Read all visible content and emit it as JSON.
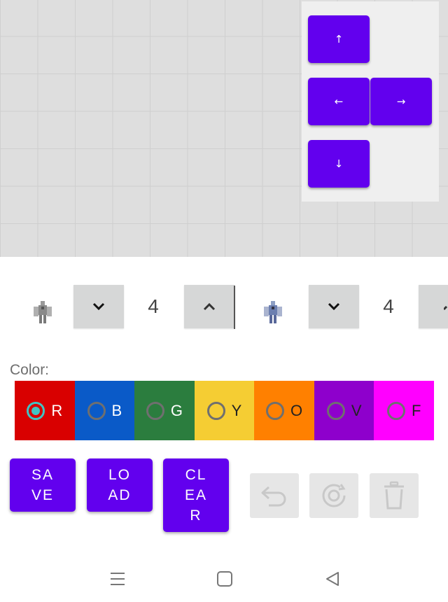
{
  "dpad": {
    "up": "↑",
    "left": "←",
    "right": "→",
    "down": "↓"
  },
  "counters": [
    {
      "sprite": "grey-robot-sprite-icon",
      "value": "4"
    },
    {
      "sprite": "blue-robot-sprite-icon",
      "value": "4"
    }
  ],
  "color_section": {
    "label": "Color:",
    "options": [
      {
        "letter": "R",
        "color": "#d90000",
        "text_color": "#ffffff",
        "checked": true
      },
      {
        "letter": "B",
        "color": "#0a5ac8",
        "text_color": "#ffffff",
        "checked": false
      },
      {
        "letter": "G",
        "color": "#2b7d3e",
        "text_color": "#ffffff",
        "checked": false
      },
      {
        "letter": "Y",
        "color": "#f5cd33",
        "text_color": "#222222",
        "checked": false
      },
      {
        "letter": "O",
        "color": "#ff8000",
        "text_color": "#222222",
        "checked": false
      },
      {
        "letter": "V",
        "color": "#8e00cc",
        "text_color": "#222222",
        "checked": false
      },
      {
        "letter": "F",
        "color": "#ff00ff",
        "text_color": "#222222",
        "checked": false
      }
    ]
  },
  "actions": {
    "save": "SAVE",
    "load": "LOAD",
    "clear": "CLEAR"
  },
  "tools": [
    "undo-icon",
    "redo-icon",
    "trash-icon"
  ],
  "navbar": [
    "menu-icon",
    "home-icon",
    "back-icon"
  ],
  "colors": {
    "accent": "#6200ee",
    "canvas": "#dedede",
    "spinner": "#d6d7d7"
  }
}
